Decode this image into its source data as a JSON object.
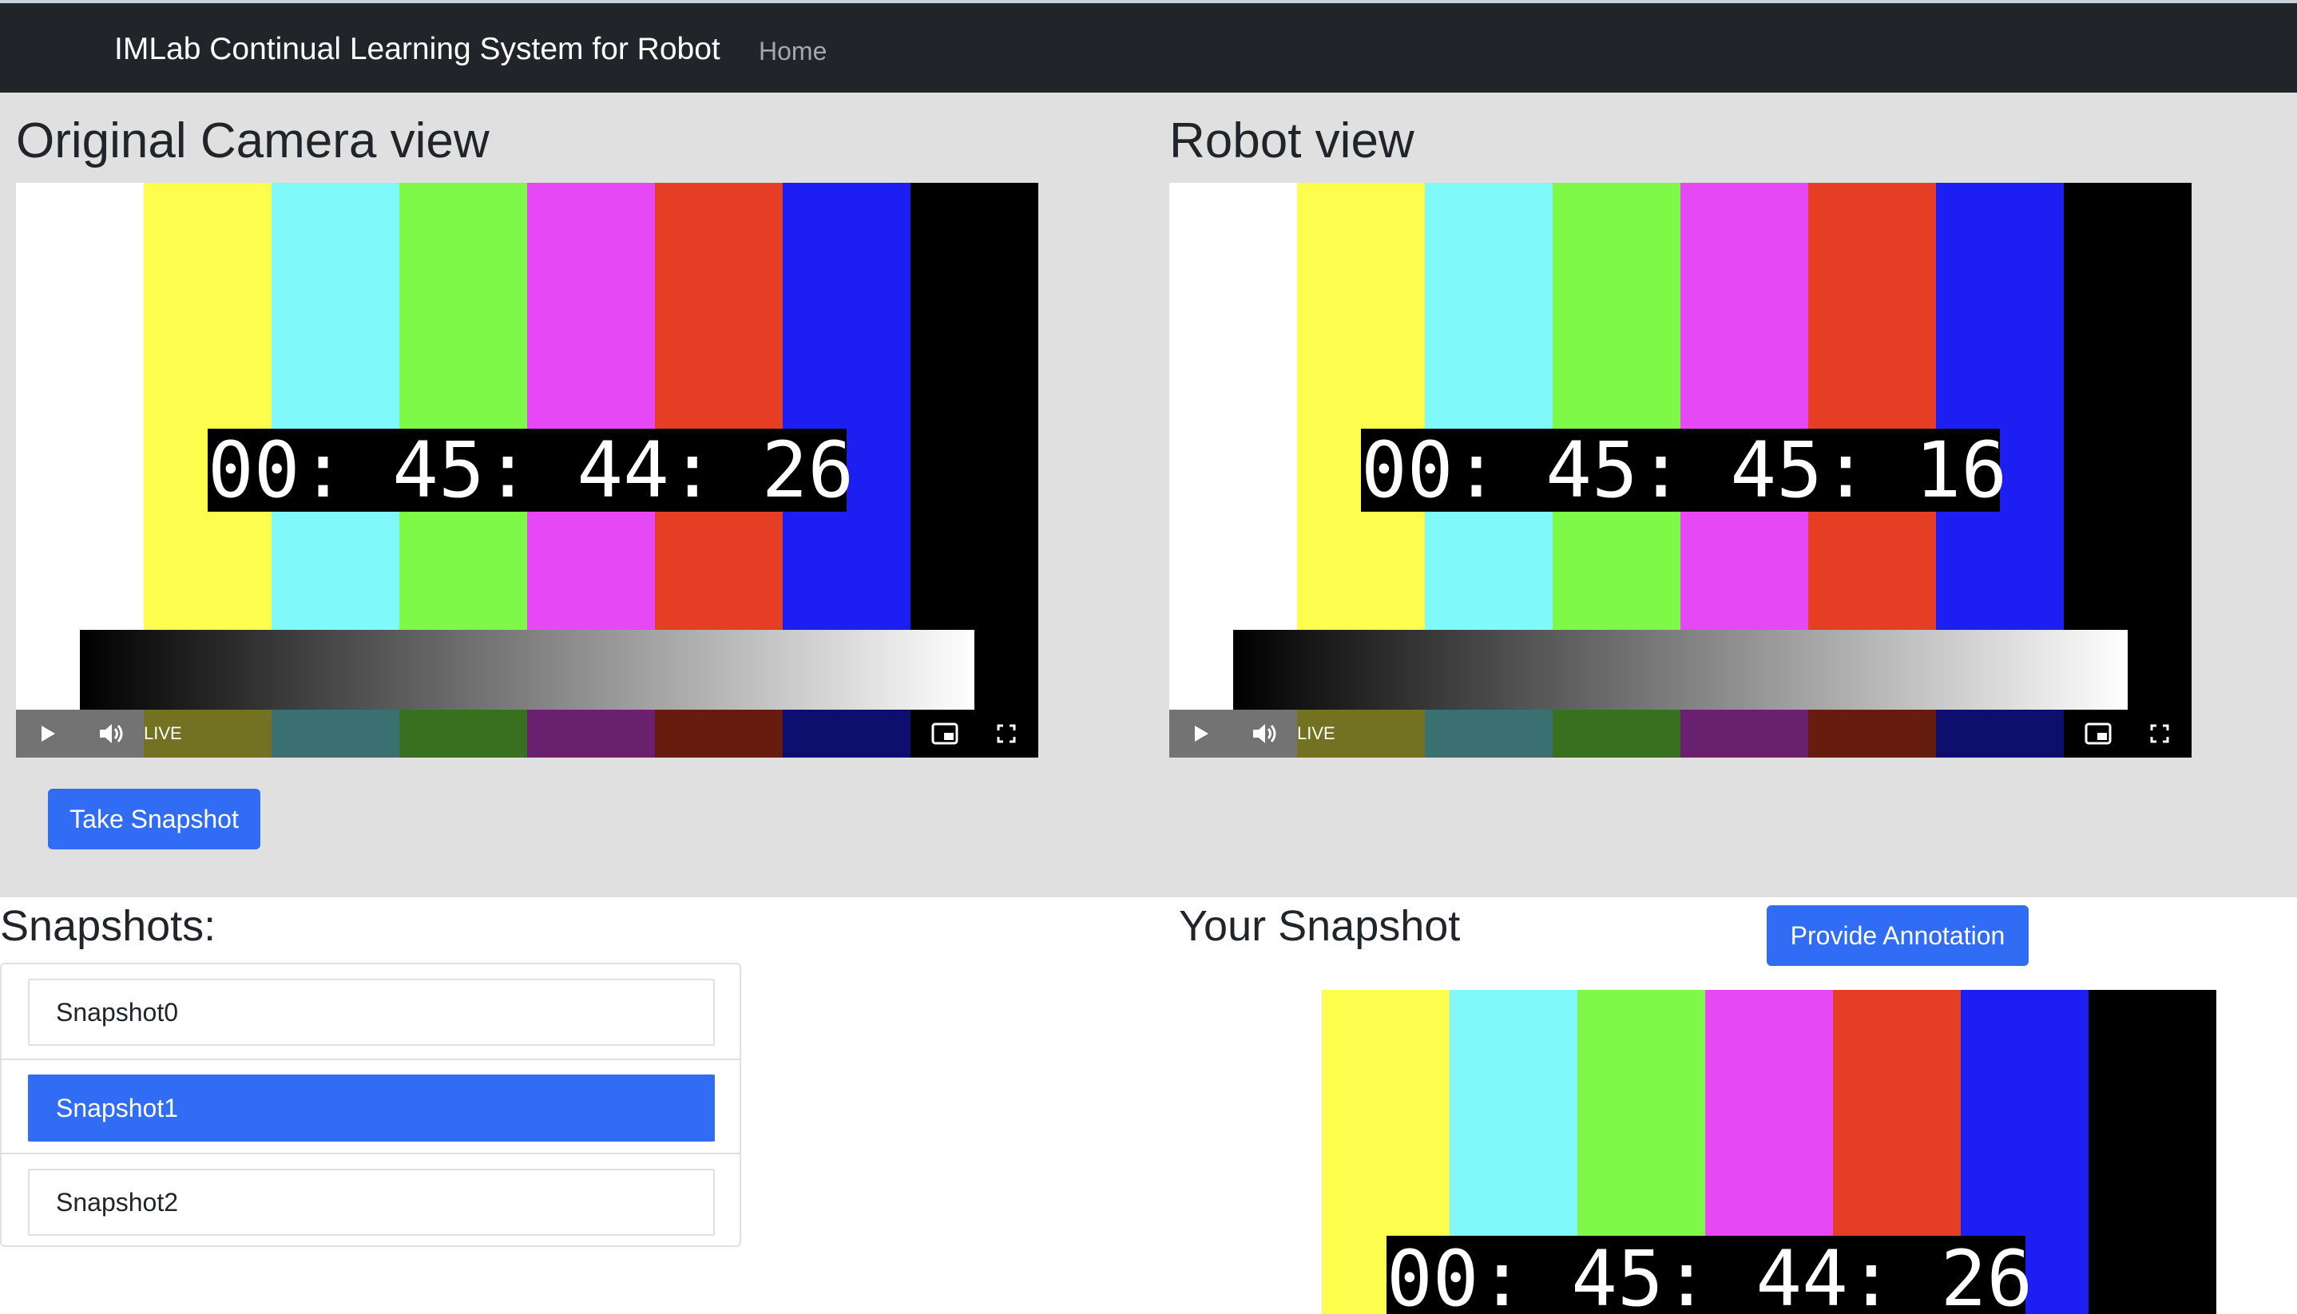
{
  "navbar": {
    "brand": "IMLab Continual Learning System for Robot",
    "home_link": "Home"
  },
  "camera": {
    "title": "Original Camera view",
    "timecode": "00: 45: 44: 26",
    "live_label": "LIVE",
    "icons": [
      "play-icon",
      "volume-icon",
      "picture-in-picture-icon",
      "fullscreen-icon"
    ]
  },
  "robot": {
    "title": "Robot view",
    "timecode": "00: 45: 45: 16",
    "live_label": "LIVE",
    "icons": [
      "play-icon",
      "volume-icon",
      "picture-in-picture-icon",
      "fullscreen-icon"
    ]
  },
  "test_pattern": {
    "bar_colors": [
      "#ffffff",
      "#fdfd4d",
      "#80f9fb",
      "#7ff948",
      "#e748f6",
      "#e53e24",
      "#1d1ff2",
      "#000000"
    ],
    "gradient": [
      "#000000",
      "#ffffff"
    ]
  },
  "actions": {
    "take_snapshot": "Take Snapshot",
    "provide_annotation": "Provide Annotation"
  },
  "snapshots": {
    "title": "Snapshots:",
    "items": [
      {
        "label": "Snapshot0",
        "selected": false
      },
      {
        "label": "Snapshot1",
        "selected": true
      },
      {
        "label": "Snapshot2",
        "selected": false
      }
    ]
  },
  "your_snapshot": {
    "title": "Your Snapshot",
    "timecode": "00: 45: 44: 26"
  },
  "colors": {
    "navbar_bg": "#212529",
    "section_bg": "#e0e0e0",
    "accent": "#316cf4"
  }
}
